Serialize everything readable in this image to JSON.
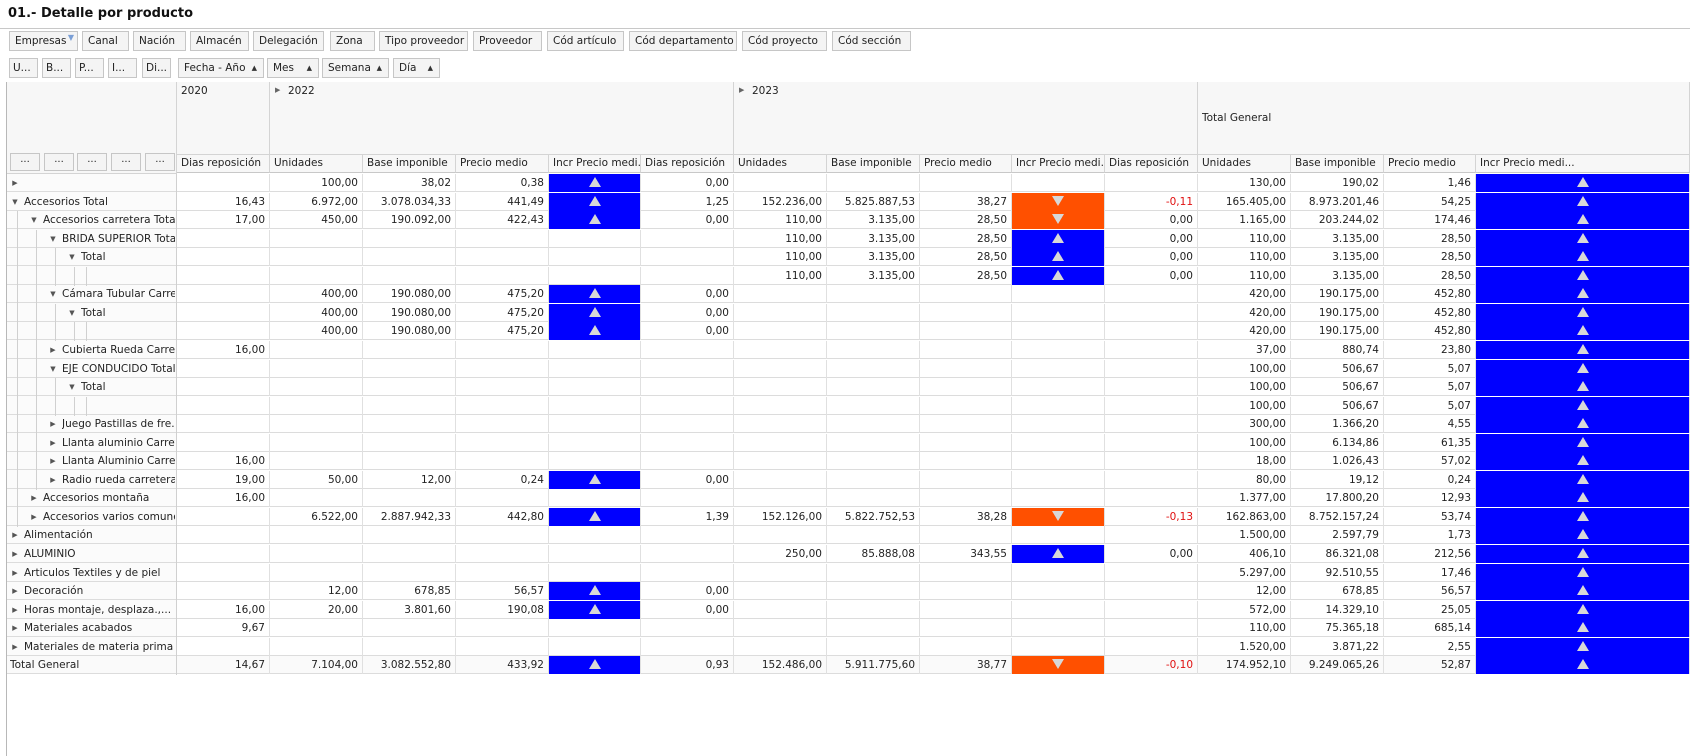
{
  "title": "01.- Detalle por producto",
  "filters": [
    "Empresas",
    "Canal",
    "Nación",
    "Almacén",
    "Delegación",
    "Zona",
    "Tipo proveedor",
    "Proveedor",
    "Cód artículo",
    "Cód departamento",
    "Cód proyecto",
    "Cód sección"
  ],
  "row_fields": [
    "U...",
    "B...",
    "P...",
    "I...",
    "Di..."
  ],
  "column_fields": [
    "Fecha - Año",
    "Mes",
    "Semana",
    "Día"
  ],
  "row_header_buttons": [
    "...",
    "...",
    "...",
    "...",
    "..."
  ],
  "years": [
    "2020",
    "2022",
    "2023",
    "Total General"
  ],
  "columns": [
    "Dias reposición",
    "Unidades",
    "Base imponible",
    "Precio medio",
    "Incr Precio medi...",
    "Dias reposición",
    "Unidades",
    "Base imponible",
    "Precio medio",
    "Incr Precio medi...",
    "Dias reposición",
    "Unidades",
    "Base imponible",
    "Precio medio",
    "Incr Precio medi..."
  ],
  "indicator_colors": {
    "up": "#0000ff",
    "down": "#ff5000"
  },
  "rows": [
    {
      "label": "",
      "level": 0,
      "exp": "right",
      "cells": [
        "",
        "100,00",
        "38,02",
        "0,38",
        "up",
        "0,00",
        "",
        "",
        "",
        "",
        "",
        "130,00",
        "190,02",
        "1,46",
        "up"
      ]
    },
    {
      "label": "Accesorios Total",
      "level": 0,
      "exp": "down",
      "cells": [
        "16,43",
        "6.972,00",
        "3.078.034,33",
        "441,49",
        "up",
        "1,25",
        "152.236,00",
        "5.825.887,53",
        "38,27",
        "down",
        "-0,11",
        "165.405,00",
        "8.973.201,46",
        "54,25",
        "up"
      ]
    },
    {
      "label": "Accesorios carretera Total",
      "level": 1,
      "exp": "down",
      "cells": [
        "17,00",
        "450,00",
        "190.092,00",
        "422,43",
        "up",
        "0,00",
        "110,00",
        "3.135,00",
        "28,50",
        "down",
        "0,00",
        "1.165,00",
        "203.244,02",
        "174,46",
        "up"
      ]
    },
    {
      "label": "BRIDA SUPERIOR Total",
      "level": 2,
      "exp": "down",
      "cells": [
        "",
        "",
        "",
        "",
        "",
        "",
        "110,00",
        "3.135,00",
        "28,50",
        "up",
        "0,00",
        "110,00",
        "3.135,00",
        "28,50",
        "up"
      ]
    },
    {
      "label": "Total",
      "level": 3,
      "exp": "down",
      "cells": [
        "",
        "",
        "",
        "",
        "",
        "",
        "110,00",
        "3.135,00",
        "28,50",
        "up",
        "0,00",
        "110,00",
        "3.135,00",
        "28,50",
        "up"
      ]
    },
    {
      "label": "",
      "level": 4,
      "exp": "",
      "cells": [
        "",
        "",
        "",
        "",
        "",
        "",
        "110,00",
        "3.135,00",
        "28,50",
        "up",
        "0,00",
        "110,00",
        "3.135,00",
        "28,50",
        "up"
      ]
    },
    {
      "label": "Cámara Tubular Carre...",
      "level": 2,
      "exp": "down",
      "cells": [
        "",
        "400,00",
        "190.080,00",
        "475,20",
        "up",
        "0,00",
        "",
        "",
        "",
        "",
        "",
        "420,00",
        "190.175,00",
        "452,80",
        "up"
      ]
    },
    {
      "label": "Total",
      "level": 3,
      "exp": "down",
      "cells": [
        "",
        "400,00",
        "190.080,00",
        "475,20",
        "up",
        "0,00",
        "",
        "",
        "",
        "",
        "",
        "420,00",
        "190.175,00",
        "452,80",
        "up"
      ]
    },
    {
      "label": "",
      "level": 4,
      "exp": "",
      "cells": [
        "",
        "400,00",
        "190.080,00",
        "475,20",
        "up",
        "0,00",
        "",
        "",
        "",
        "",
        "",
        "420,00",
        "190.175,00",
        "452,80",
        "up"
      ]
    },
    {
      "label": "Cubierta Rueda Carre...",
      "level": 2,
      "exp": "right",
      "cells": [
        "16,00",
        "",
        "",
        "",
        "",
        "",
        "",
        "",
        "",
        "",
        "",
        "37,00",
        "880,74",
        "23,80",
        "up"
      ]
    },
    {
      "label": "EJE CONDUCIDO Total",
      "level": 2,
      "exp": "down",
      "cells": [
        "",
        "",
        "",
        "",
        "",
        "",
        "",
        "",
        "",
        "",
        "",
        "100,00",
        "506,67",
        "5,07",
        "up"
      ]
    },
    {
      "label": "Total",
      "level": 3,
      "exp": "down",
      "cells": [
        "",
        "",
        "",
        "",
        "",
        "",
        "",
        "",
        "",
        "",
        "",
        "100,00",
        "506,67",
        "5,07",
        "up"
      ]
    },
    {
      "label": "",
      "level": 4,
      "exp": "",
      "cells": [
        "",
        "",
        "",
        "",
        "",
        "",
        "",
        "",
        "",
        "",
        "",
        "100,00",
        "506,67",
        "5,07",
        "up"
      ]
    },
    {
      "label": "Juego Pastillas de fre...",
      "level": 2,
      "exp": "right",
      "cells": [
        "",
        "",
        "",
        "",
        "",
        "",
        "",
        "",
        "",
        "",
        "",
        "300,00",
        "1.366,20",
        "4,55",
        "up"
      ]
    },
    {
      "label": "Llanta aluminio Carret...",
      "level": 2,
      "exp": "right",
      "cells": [
        "",
        "",
        "",
        "",
        "",
        "",
        "",
        "",
        "",
        "",
        "",
        "100,00",
        "6.134,86",
        "61,35",
        "up"
      ]
    },
    {
      "label": "Llanta Aluminio Carret...",
      "level": 2,
      "exp": "right",
      "cells": [
        "16,00",
        "",
        "",
        "",
        "",
        "",
        "",
        "",
        "",
        "",
        "",
        "18,00",
        "1.026,43",
        "57,02",
        "up"
      ]
    },
    {
      "label": "Radio rueda carretera",
      "level": 2,
      "exp": "right",
      "cells": [
        "19,00",
        "50,00",
        "12,00",
        "0,24",
        "up",
        "0,00",
        "",
        "",
        "",
        "",
        "",
        "80,00",
        "19,12",
        "0,24",
        "up"
      ]
    },
    {
      "label": "Accesorios montaña",
      "level": 1,
      "exp": "right",
      "cells": [
        "16,00",
        "",
        "",
        "",
        "",
        "",
        "",
        "",
        "",
        "",
        "",
        "1.377,00",
        "17.800,20",
        "12,93",
        "up"
      ]
    },
    {
      "label": "Accesorios varios comunes",
      "level": 1,
      "exp": "right",
      "cells": [
        "",
        "6.522,00",
        "2.887.942,33",
        "442,80",
        "up",
        "1,39",
        "152.126,00",
        "5.822.752,53",
        "38,28",
        "down",
        "-0,13",
        "162.863,00",
        "8.752.157,24",
        "53,74",
        "up"
      ]
    },
    {
      "label": "Alimentación",
      "level": 0,
      "exp": "right",
      "cells": [
        "",
        "",
        "",
        "",
        "",
        "",
        "",
        "",
        "",
        "",
        "",
        "1.500,00",
        "2.597,79",
        "1,73",
        "up"
      ]
    },
    {
      "label": "ALUMINIO",
      "level": 0,
      "exp": "right",
      "cells": [
        "",
        "",
        "",
        "",
        "",
        "",
        "250,00",
        "85.888,08",
        "343,55",
        "up",
        "0,00",
        "406,10",
        "86.321,08",
        "212,56",
        "up"
      ]
    },
    {
      "label": "Articulos Textiles y de piel",
      "level": 0,
      "exp": "right",
      "cells": [
        "",
        "",
        "",
        "",
        "",
        "",
        "",
        "",
        "",
        "",
        "",
        "5.297,00",
        "92.510,55",
        "17,46",
        "up"
      ]
    },
    {
      "label": "Decoración",
      "level": 0,
      "exp": "right",
      "cells": [
        "",
        "12,00",
        "678,85",
        "56,57",
        "up",
        "0,00",
        "",
        "",
        "",
        "",
        "",
        "12,00",
        "678,85",
        "56,57",
        "up"
      ]
    },
    {
      "label": "Horas montaje, desplaza.,...",
      "level": 0,
      "exp": "right",
      "cells": [
        "16,00",
        "20,00",
        "3.801,60",
        "190,08",
        "up",
        "0,00",
        "",
        "",
        "",
        "",
        "",
        "572,00",
        "14.329,10",
        "25,05",
        "up"
      ]
    },
    {
      "label": "Materiales acabados",
      "level": 0,
      "exp": "right",
      "cells": [
        "9,67",
        "",
        "",
        "",
        "",
        "",
        "",
        "",
        "",
        "",
        "",
        "110,00",
        "75.365,18",
        "685,14",
        "up"
      ]
    },
    {
      "label": "Materiales de materia prima",
      "level": 0,
      "exp": "right",
      "cells": [
        "",
        "",
        "",
        "",
        "",
        "",
        "",
        "",
        "",
        "",
        "",
        "1.520,00",
        "3.871,22",
        "2,55",
        "up"
      ]
    },
    {
      "label": "Total General",
      "level": -1,
      "exp": "",
      "cells": [
        "14,67",
        "7.104,00",
        "3.082.552,80",
        "433,92",
        "up",
        "0,93",
        "152.486,00",
        "5.911.775,60",
        "38,77",
        "down",
        "-0,10",
        "174.952,10",
        "9.249.065,26",
        "52,87",
        "up"
      ]
    }
  ]
}
